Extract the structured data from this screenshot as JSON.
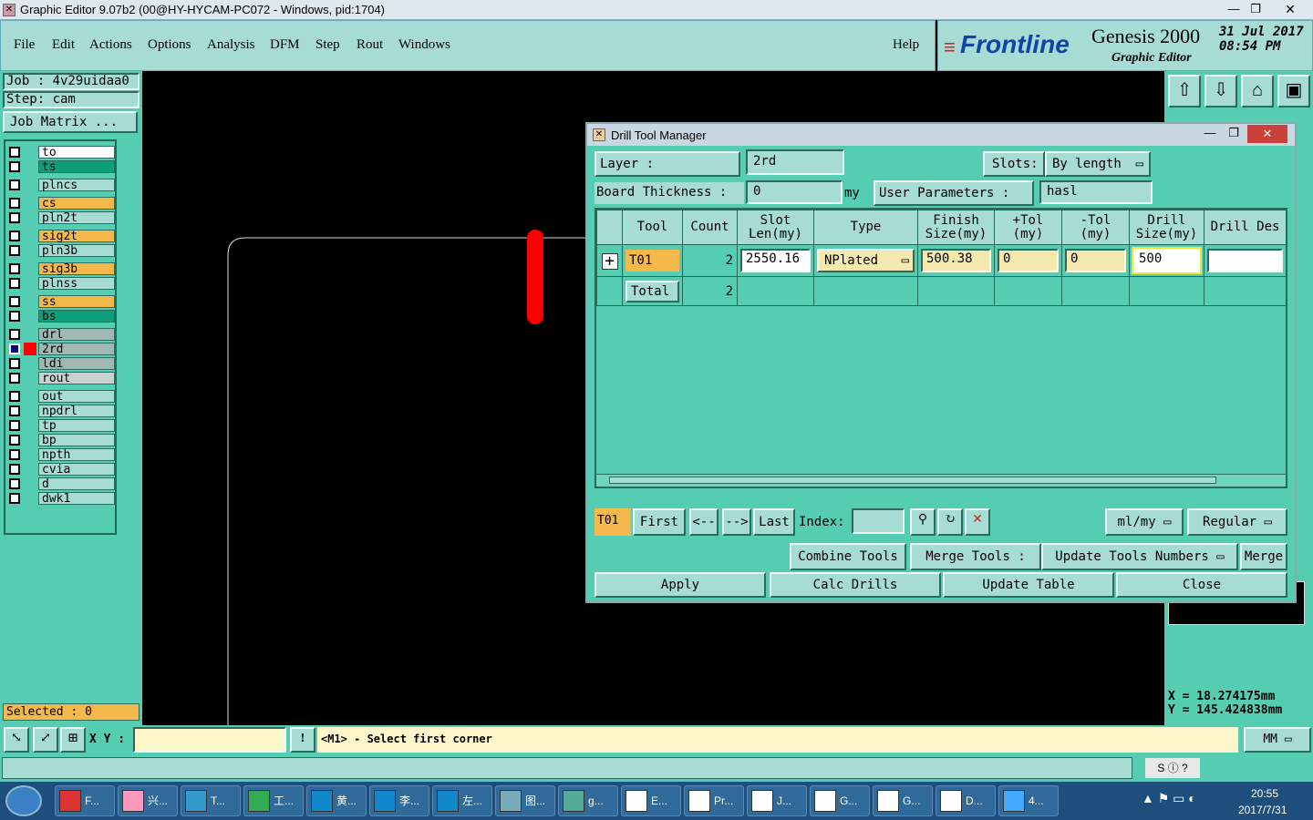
{
  "window": {
    "title": "Graphic Editor 9.07b2 (00@HY-HYCAM-PC072 - Windows, pid:1704)"
  },
  "menu": {
    "items": [
      "File",
      "Edit",
      "Actions",
      "Options",
      "Analysis",
      "DFM",
      "Step",
      "Rout",
      "Windows"
    ],
    "help": "Help"
  },
  "brand": {
    "logo": "Frontline",
    "product": "Genesis 2000",
    "subtitle": "Graphic Editor",
    "date": "31 Jul 2017",
    "time": "08:54 PM"
  },
  "job": {
    "job_label": "Job : 4v29uidaa0",
    "step_label": "Step: cam",
    "matrix_button": "Job Matrix ..."
  },
  "layers": [
    {
      "name": "to",
      "color": "#ffffff"
    },
    {
      "name": "ts",
      "color": "#0e9f7a"
    },
    {
      "name": "plncs",
      "color": "#a7dcd5"
    },
    {
      "name": "cs",
      "color": "#f5b84a"
    },
    {
      "name": "pln2t",
      "color": "#a7dcd5"
    },
    {
      "name": "sig2t",
      "color": "#f5b84a"
    },
    {
      "name": "pln3b",
      "color": "#a7dcd5"
    },
    {
      "name": "sig3b",
      "color": "#f5b84a"
    },
    {
      "name": "plnss",
      "color": "#a7dcd5"
    },
    {
      "name": "ss",
      "color": "#f5b84a"
    },
    {
      "name": "bs",
      "color": "#0e9f7a"
    },
    {
      "name": "drl",
      "color": "#9fb8b4"
    },
    {
      "name": "2rd",
      "color": "#9fb8b4"
    },
    {
      "name": "ldi",
      "color": "#9fb8b4"
    },
    {
      "name": "rout",
      "color": "#c9d2d0"
    },
    {
      "name": "out",
      "color": "#a7dcd5"
    },
    {
      "name": "npdrl",
      "color": "#a7dcd5"
    },
    {
      "name": "tp",
      "color": "#a7dcd5"
    },
    {
      "name": "bp",
      "color": "#a7dcd5"
    },
    {
      "name": "npth",
      "color": "#a7dcd5"
    },
    {
      "name": "cvia",
      "color": "#a7dcd5"
    },
    {
      "name": "d",
      "color": "#a7dcd5"
    },
    {
      "name": "dwk1",
      "color": "#a7dcd5"
    }
  ],
  "selected": "Selected : 0",
  "coords": {
    "x": "X  =  18.274175mm",
    "y": "Y  =  145.424838mm"
  },
  "dialog": {
    "title": "Drill Tool Manager",
    "layer_label": "Layer         :",
    "layer_value": "2rd",
    "slots_label": "Slots:",
    "slots_value": "By length",
    "board_label": "Board Thickness :",
    "board_value": "0",
    "board_unit": "my",
    "user_params_label": "User Parameters :",
    "user_params_value": "hasl",
    "columns": [
      "Tool",
      "Count",
      "Slot Len(my)",
      "Type",
      "Finish Size(my)",
      "+Tol (my)",
      "-Tol (my)",
      "Drill Size(my)",
      "Drill Des"
    ],
    "rows": [
      {
        "tool": "T01",
        "count": "2",
        "slot_len": "2550.16",
        "type": "NPlated",
        "finish": "500.38",
        "ptol": "0",
        "mtol": "0",
        "drill": "500",
        "des": ""
      }
    ],
    "total": {
      "label": "Total",
      "count": "2"
    },
    "nav": {
      "current": "T01",
      "first": "First",
      "prev": "<--",
      "next": "-->",
      "last": "Last",
      "index_label": "Index:",
      "units": "ml/my",
      "mode": "Regular"
    },
    "tools": {
      "combine": "Combine Tools",
      "merge_label": "Merge Tools :",
      "update_numbers": "Update Tools Numbers",
      "merge": "Merge"
    },
    "actions": {
      "apply": "Apply",
      "calc": "Calc Drills",
      "update": "Update Table",
      "close": "Close"
    }
  },
  "status": {
    "xy_label": "X Y :",
    "prompt": "<M1> - Select first corner",
    "unit": "MM"
  },
  "taskbar": {
    "items": [
      "F...",
      "兴...",
      "T...",
      "工...",
      "黄...",
      "李...",
      "左...",
      "图...",
      "g...",
      "E...",
      "Pr...",
      "J...",
      "G...",
      "G...",
      "D...",
      "4..."
    ],
    "clock_time": "20:55",
    "clock_date": "2017/7/31"
  }
}
